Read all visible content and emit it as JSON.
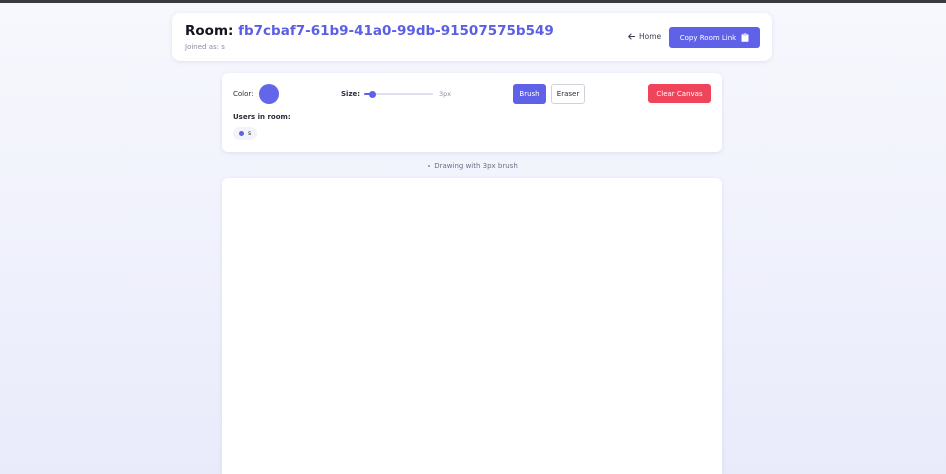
{
  "header": {
    "room_label": "Room: ",
    "room_id": "fb7cbaf7-61b9-41a0-99db-91507575b549",
    "joined_text": "Joined as: s",
    "home_label": "Home",
    "copy_label": "Copy Room Link"
  },
  "toolbar": {
    "color_label": "Color:",
    "color_value": "#6466ea",
    "size_label": "Size:",
    "size_value_text": "3px",
    "size_fraction": 0.13,
    "brush_label": "Brush",
    "eraser_label": "Eraser",
    "clear_label": "Clear Canvas",
    "users_label": "Users in room:",
    "users": [
      {
        "name": "s"
      }
    ]
  },
  "status": {
    "text": "Drawing with 3px brush"
  },
  "colors": {
    "accent": "#5f62e8",
    "danger": "#f0445a"
  },
  "icons": {
    "home": "arrow-left-icon",
    "copy": "clipboard-icon"
  }
}
